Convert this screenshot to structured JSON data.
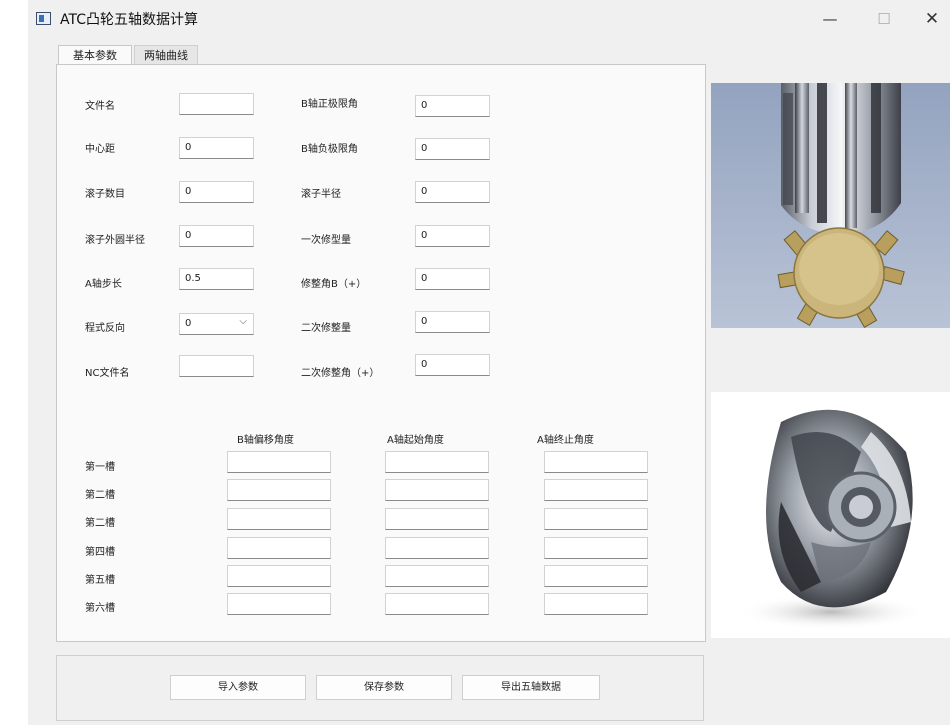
{
  "window": {
    "title": "ATC凸轮五轴数据计算",
    "minimize_glyph": "—",
    "maximize_glyph": "☐",
    "close_glyph": "✕"
  },
  "tabs": [
    {
      "label": "基本参数",
      "active": true
    },
    {
      "label": "两轴曲线",
      "active": false
    }
  ],
  "params_left": [
    {
      "label": "文件名",
      "value": ""
    },
    {
      "label": "中心距",
      "value": "0"
    },
    {
      "label": "滚子数目",
      "value": "0"
    },
    {
      "label": "滚子外圆半径",
      "value": "0"
    },
    {
      "label": "A轴步长",
      "value": "0.5"
    },
    {
      "label": "程式反向",
      "value": "0"
    },
    {
      "label": "NC文件名",
      "value": ""
    }
  ],
  "combo_caret": "⌵",
  "params_right": [
    {
      "label": "B轴正极限角",
      "value": "0"
    },
    {
      "label": "B轴负极限角",
      "value": "0"
    },
    {
      "label": "滚子半径",
      "value": "0"
    },
    {
      "label": "一次修型量",
      "value": "0"
    },
    {
      "label": "修整角B（+）",
      "value": "0"
    },
    {
      "label": "二次修整量",
      "value": "0"
    },
    {
      "label": "二次修整角（+）",
      "value": "0"
    }
  ],
  "slot_table": {
    "headers": [
      "B轴偏移角度",
      "A轴起始角度",
      "A轴终止角度"
    ],
    "rows": [
      "第一槽",
      "第二槽",
      "第二槽",
      "第四槽",
      "第五槽",
      "第六槽"
    ]
  },
  "buttons": [
    "导入参数",
    "保存参数",
    "导出五轴数据"
  ],
  "colors": {
    "accent_blue": "#3b6fb3",
    "cam_gold": "#c8b47a"
  }
}
